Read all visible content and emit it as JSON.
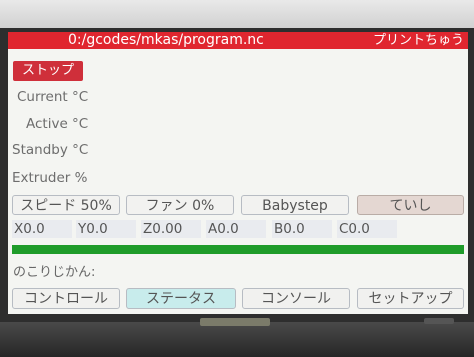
{
  "header": {
    "path": "0:/gcodes/mkas/program.nc",
    "status": "プリントちゅう"
  },
  "stop_button": "ストップ",
  "labels": {
    "current": "Current °C",
    "active": "Active °C",
    "standby": "Standby °C",
    "extruder": "Extruder %"
  },
  "buttons": {
    "speed": "スピード 50%",
    "fan": "ファン 0%",
    "babystep": "Babystep",
    "pause": "ていし"
  },
  "axes": {
    "x": "X0.0",
    "y": "Y0.0",
    "z": "Z0.00",
    "a": "A0.0",
    "b": "B0.0",
    "c": "C0.0"
  },
  "progress": {
    "fraction": 1.0,
    "color": "#1f9c2a"
  },
  "remaining_label": "のこりじかん:",
  "tabs": [
    "コントロール",
    "ステータス",
    "コンソール",
    "セットアップ"
  ],
  "active_tab": "ステータス",
  "colors": {
    "title_bar": "#e0262f",
    "stop_button": "#cf2f3a",
    "active_tab": "#c8ecec"
  }
}
